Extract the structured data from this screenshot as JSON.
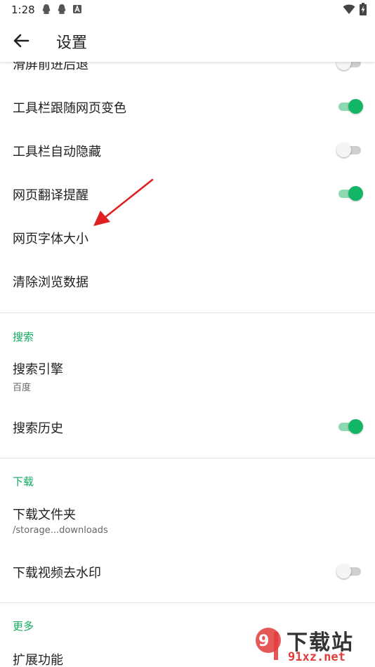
{
  "status_bar": {
    "time": "1:28",
    "left_icons": [
      "qq-icon",
      "qq-icon",
      "notification-a-icon"
    ],
    "right_icons": [
      "wifi-icon",
      "battery-charging-icon"
    ]
  },
  "app_bar": {
    "back_icon": "arrow-left-icon",
    "title": "设置"
  },
  "general_items": [
    {
      "label": "滑屏前进后退",
      "toggle": "off"
    },
    {
      "label": "工具栏跟随网页变色",
      "toggle": "on"
    },
    {
      "label": "工具栏自动隐藏",
      "toggle": "off"
    },
    {
      "label": "网页翻译提醒",
      "toggle": "on"
    },
    {
      "label": "网页字体大小"
    },
    {
      "label": "清除浏览数据"
    }
  ],
  "search_section": {
    "header": "搜索",
    "engine_label": "搜索引擎",
    "engine_value": "百度",
    "history_label": "搜索历史",
    "history_toggle": "on"
  },
  "download_section": {
    "header": "下载",
    "folder_label": "下载文件夹",
    "folder_value": "/storage...downloads",
    "watermark_label": "下载视频去水印",
    "watermark_toggle": "off"
  },
  "more_section": {
    "header": "更多",
    "extensions_label": "扩展功能"
  },
  "site_watermark": {
    "top_text": "下载站",
    "bottom_text": "91xz.net"
  },
  "colors": {
    "accent": "#13b567",
    "section_header": "#13a960",
    "annotation_arrow": "#e02020"
  }
}
